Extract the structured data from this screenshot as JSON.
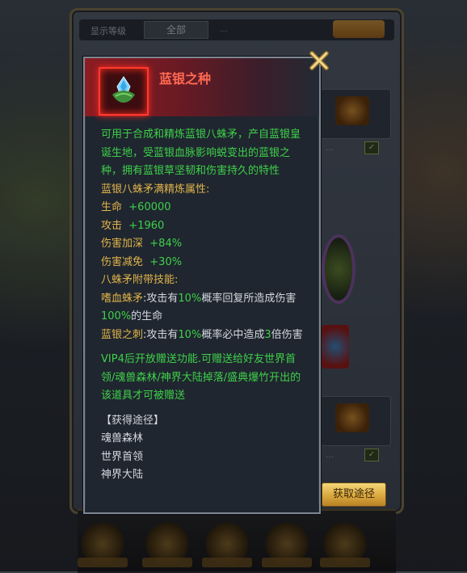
{
  "item": {
    "name": "蓝银之种",
    "icon": "blue-silver-seed-icon",
    "description": "可用于合成和精炼蓝银八蛛矛，产自蓝银皇诞生地，受蓝银血脉影响蜕变出的蓝银之种，拥有蓝银草坚韧和伤害持久的特性",
    "refine_header": "蓝银八蛛矛满精炼属性:",
    "stats": [
      {
        "label": "生命",
        "value": "+60000"
      },
      {
        "label": "攻击",
        "value": "+1960"
      },
      {
        "label": "伤害加深",
        "value": "+84%"
      },
      {
        "label": "伤害减免",
        "value": "+30%"
      }
    ],
    "skills_header": "八蛛矛附带技能:",
    "skill1": {
      "name": "嗜血蛛矛",
      "t1": ":攻击有",
      "v1": "10%",
      "t2": "概率回复所造成伤害",
      "v2": "100%",
      "t3": "的生命"
    },
    "skill2": {
      "name": "蓝银之刺",
      "t1": ":攻击有",
      "v1": "10%",
      "t2": "概率必中造成",
      "v2": "3",
      "t3": "倍伤害"
    },
    "gift_note": "VIP4后开放赠送功能.可赠送给好友世界首领/魂兽森林/神界大陆掉落/盛典爆竹开出的该道具才可被赠送",
    "source_header": "【获得途径】",
    "sources": [
      "魂兽森林",
      "世界首领",
      "神界大陆"
    ]
  },
  "buttons": {
    "get_path": "获取途径"
  },
  "colors": {
    "item_name": "#ff6a52",
    "highlight_green": "#3fd04a",
    "header_gold": "#e1b34b",
    "button_gold": "#d9a93e"
  }
}
